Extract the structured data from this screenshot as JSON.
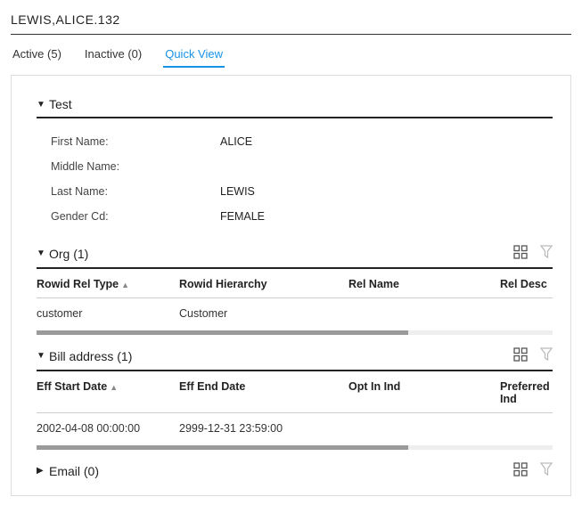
{
  "title": "LEWIS,ALICE.132",
  "tabs": [
    {
      "label": "Active (5)"
    },
    {
      "label": "Inactive (0)"
    },
    {
      "label": "Quick View"
    }
  ],
  "activeTabIndex": 2,
  "sections": {
    "test": {
      "title": "Test",
      "expanded": true,
      "fields": [
        {
          "label": "First Name:",
          "value": "ALICE"
        },
        {
          "label": "Middle Name:",
          "value": ""
        },
        {
          "label": "Last Name:",
          "value": "LEWIS"
        },
        {
          "label": "Gender Cd:",
          "value": "FEMALE"
        }
      ]
    },
    "org": {
      "title": "Org (1)",
      "expanded": true,
      "columns": [
        "Rowid Rel Type",
        "Rowid Hierarchy",
        "Rel Name",
        "Rel Desc"
      ],
      "sortColumnIndex": 0,
      "rows": [
        {
          "c1": "customer",
          "c2": "Customer",
          "c3": "",
          "c4": ""
        }
      ],
      "scrollThumbPercent": 72
    },
    "bill": {
      "title": "Bill address (1)",
      "expanded": true,
      "columns": [
        "Eff Start Date",
        "Eff End Date",
        "Opt In Ind",
        "Preferred Ind"
      ],
      "sortColumnIndex": 0,
      "rows": [
        {
          "c1": "2002-04-08 00:00:00",
          "c2": "2999-12-31 23:59:00",
          "c3": "",
          "c4": ""
        }
      ],
      "scrollThumbPercent": 72
    },
    "email": {
      "title": "Email (0)",
      "expanded": false
    }
  },
  "icons": {
    "caretDown": "▼",
    "caretRight": "▶",
    "sortAsc": "▲"
  }
}
